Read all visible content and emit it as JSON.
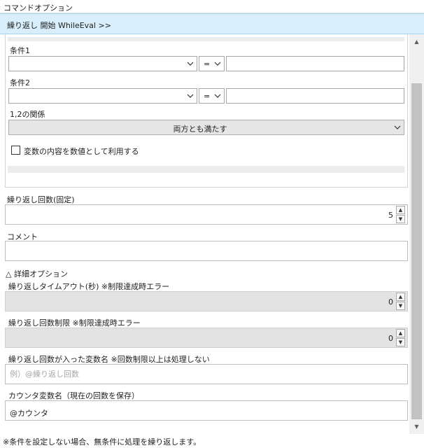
{
  "panel": {
    "title": "コマンドオプション"
  },
  "header": {
    "label": "繰り返し 開始 WhileEval >>"
  },
  "conditions": {
    "cond1_label": "条件1",
    "cond1_operator": "=",
    "cond2_label": "条件2",
    "cond2_operator": "=",
    "relation_label": "1,2の関係",
    "relation_value": "両方とも満たす",
    "numeric_checkbox_label": "変数の内容を数値として利用する",
    "numeric_checkbox_checked": false
  },
  "repeat_count": {
    "label": "繰り返し回数(固定)",
    "value": "5"
  },
  "comment": {
    "label": "コメント",
    "value": ""
  },
  "details": {
    "toggle_glyph": "△",
    "label": "詳細オプション",
    "timeout_label": "繰り返しタイムアウト(秒) ※制限達成時エラー",
    "timeout_value": "0",
    "limit_label": "繰り返し回数制限 ※制限達成時エラー",
    "limit_value": "0",
    "count_var_label": "繰り返し回数が入った変数名 ※回数制限以上は処理しない",
    "count_var_placeholder": "例）@繰り返し回数",
    "counter_var_label": "カウンタ変数名（現在の回数を保存）",
    "counter_var_value": "@カウンタ"
  },
  "footer": {
    "note": "※条件を設定しない場合、無条件に処理を繰り返します。"
  },
  "icons": {
    "chevron": "chevron-down-icon",
    "spin_up": "▲",
    "spin_down": "▼",
    "scroll_up": "▲",
    "scroll_down": "▼"
  }
}
